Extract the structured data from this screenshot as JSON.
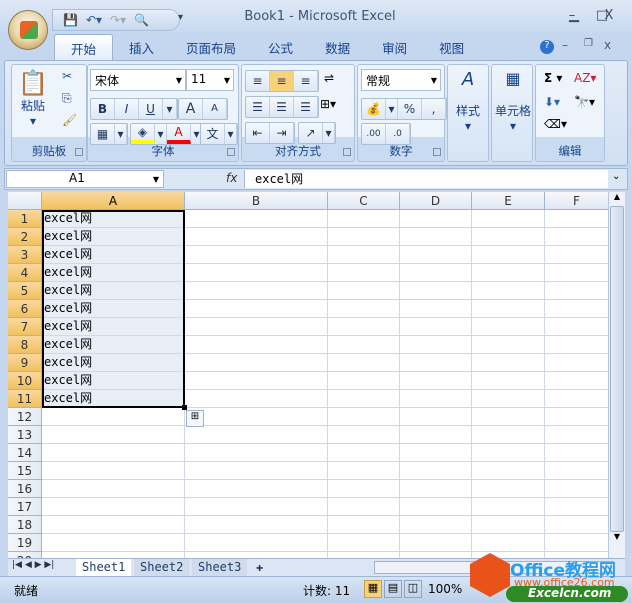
{
  "window": {
    "title": "Book1 - Microsoft Excel"
  },
  "ribbon": {
    "tabs": [
      "开始",
      "插入",
      "页面布局",
      "公式",
      "数据",
      "审阅",
      "视图"
    ],
    "active_tab": "开始",
    "groups": {
      "clipboard": {
        "label": "剪贴板",
        "paste": "粘贴"
      },
      "font": {
        "label": "字体",
        "font_name": "宋体",
        "font_size": "11",
        "bold": "B",
        "italic": "I",
        "underline": "U",
        "grow": "A",
        "shrink": "A",
        "font_color": "A",
        "phonetic": "文",
        "fill_color": "#ffff00",
        "text_color": "#ff0000"
      },
      "alignment": {
        "label": "对齐方式"
      },
      "number": {
        "label": "数字",
        "format": "常规",
        "percent": "%",
        "comma": ",",
        "inc_decimal": ".00",
        "dec_decimal": ".0"
      },
      "styles": {
        "label": "样式"
      },
      "cells": {
        "label": "单元格"
      },
      "editing": {
        "label": "编辑",
        "sum": "Σ"
      }
    }
  },
  "formula_bar": {
    "name_box": "A1",
    "fx": "fx",
    "value": "excel网"
  },
  "sheet": {
    "columns": [
      "A",
      "B",
      "C",
      "D",
      "E",
      "F"
    ],
    "rows": [
      "1",
      "2",
      "3",
      "4",
      "5",
      "6",
      "7",
      "8",
      "9",
      "10",
      "11",
      "12",
      "13",
      "14",
      "15",
      "16",
      "17",
      "18",
      "19",
      "20"
    ],
    "cells": [
      "excel网",
      "excel网",
      "excel网",
      "excel网",
      "excel网",
      "excel网",
      "excel网",
      "excel网",
      "excel网",
      "excel网",
      "excel网"
    ]
  },
  "sheet_tabs": [
    "Sheet1",
    "Sheet2",
    "Sheet3"
  ],
  "active_sheet": "Sheet1",
  "status": {
    "ready": "就绪",
    "count": "计数: 11",
    "zoom": "100%"
  },
  "watermark": {
    "brand": "Office教程网",
    "url": "www.office26.com",
    "site": "Excelcn.com"
  }
}
